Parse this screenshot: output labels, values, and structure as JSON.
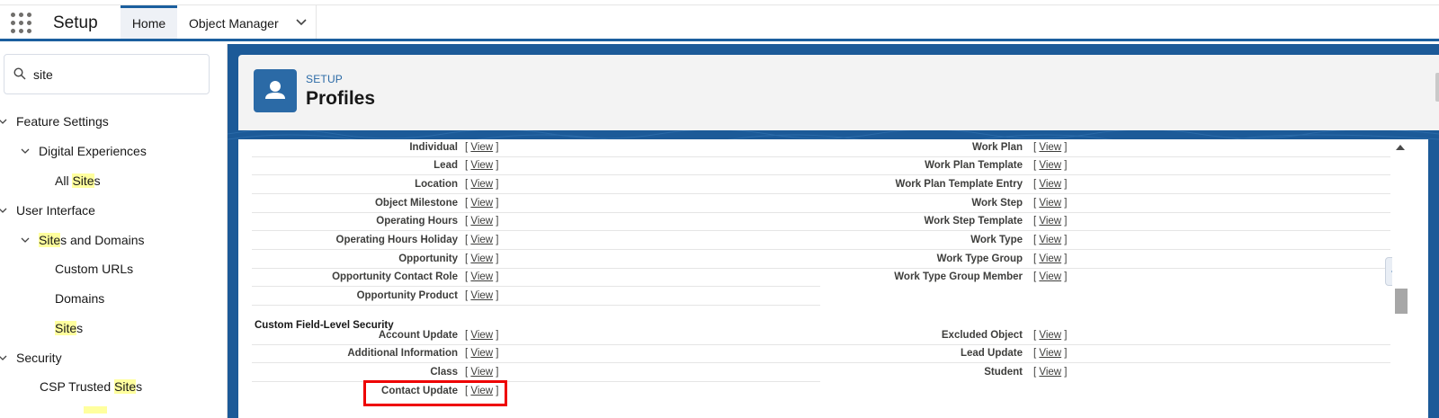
{
  "topbar": {
    "app_title": "Setup",
    "tabs": [
      {
        "label": "Home"
      },
      {
        "label": "Object Manager"
      }
    ]
  },
  "sidebar": {
    "search_value": "site",
    "items": [
      {
        "label_pre": "",
        "label_hl": "",
        "label_post": "Feature Settings"
      },
      {
        "label_pre": "",
        "label_hl": "",
        "label_post": "Digital Experiences"
      },
      {
        "label_pre": "All ",
        "label_hl": "Site",
        "label_post": "s"
      },
      {
        "label_pre": "",
        "label_hl": "",
        "label_post": "User Interface"
      },
      {
        "label_pre": "",
        "label_hl": "Site",
        "label_post": "s and Domains"
      },
      {
        "label_pre": "",
        "label_hl": "",
        "label_post": "Custom URLs"
      },
      {
        "label_pre": "",
        "label_hl": "",
        "label_post": "Domains"
      },
      {
        "label_pre": "",
        "label_hl": "Site",
        "label_post": "s"
      },
      {
        "label_pre": "",
        "label_hl": "",
        "label_post": "Security"
      },
      {
        "label_pre": "CSP Trusted ",
        "label_hl": "Site",
        "label_post": "s"
      }
    ]
  },
  "header": {
    "eyebrow": "SETUP",
    "title": "Profiles"
  },
  "view_label": "View",
  "left_rows": [
    "Individual",
    "Lead",
    "Location",
    "Object Milestone",
    "Operating Hours",
    "Operating Hours Holiday",
    "Opportunity",
    "Opportunity Contact Role",
    "Opportunity Product"
  ],
  "right_rows": [
    "Work Plan",
    "Work Plan Template",
    "Work Plan Template Entry",
    "Work Step",
    "Work Step Template",
    "Work Type",
    "Work Type Group",
    "Work Type Group Member"
  ],
  "custom_section": {
    "title": "Custom Field-Level Security",
    "left_rows": [
      "Account Update",
      "Additional Information",
      "Class",
      "Contact Update"
    ],
    "right_rows": [
      "Excluded Object",
      "Lead Update",
      "Student"
    ]
  }
}
